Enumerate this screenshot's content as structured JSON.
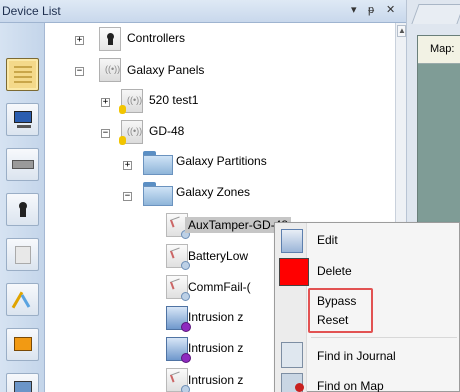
{
  "panel": {
    "title": "Device List",
    "controls": {
      "dropdown": "▾",
      "pin": "ᵽ",
      "close": "✕"
    }
  },
  "map_tab": {
    "label": "Map:"
  },
  "tree": {
    "nodes": [
      {
        "label": "Controllers",
        "icon": "keyhole-controller-icon",
        "expander": "+"
      },
      {
        "label": "Galaxy Panels",
        "icon": "panel-antenna-icon",
        "expander": "−"
      },
      {
        "label": "520 test1",
        "icon": "panel-antenna-icon",
        "expander": "+"
      },
      {
        "label": "GD-48",
        "icon": "panel-antenna-icon",
        "expander": "−"
      },
      {
        "label": "Galaxy Partitions",
        "icon": "folder-icon",
        "expander": "+"
      },
      {
        "label": "Galaxy Zones",
        "icon": "folder-icon",
        "expander": "−"
      },
      {
        "label": "AuxTamper-GD-48",
        "icon": "zone-icon"
      },
      {
        "label": "BatteryLow",
        "icon": "zone-icon"
      },
      {
        "label": "CommFail-(",
        "icon": "zone-icon"
      },
      {
        "label": "Intrusion z",
        "icon": "intrusion-zone-icon"
      },
      {
        "label": "Intrusion z",
        "icon": "intrusion-zone-icon"
      },
      {
        "label": "Intrusion z",
        "icon": "zone-icon"
      }
    ]
  },
  "context_menu": {
    "items": [
      {
        "label": "Edit",
        "icon": "edit-icon"
      },
      {
        "label": "Delete",
        "icon": "delete-icon"
      },
      {
        "label": "Bypass"
      },
      {
        "label": "Reset"
      },
      {
        "label": "Find in Journal",
        "icon": "journal-search-icon"
      },
      {
        "label": "Find on Map",
        "icon": "map-search-icon"
      }
    ]
  },
  "colors": {
    "highlight_box": "#e25252",
    "delete_red": "#ff0000",
    "selected_item": "#c6c6c6"
  }
}
